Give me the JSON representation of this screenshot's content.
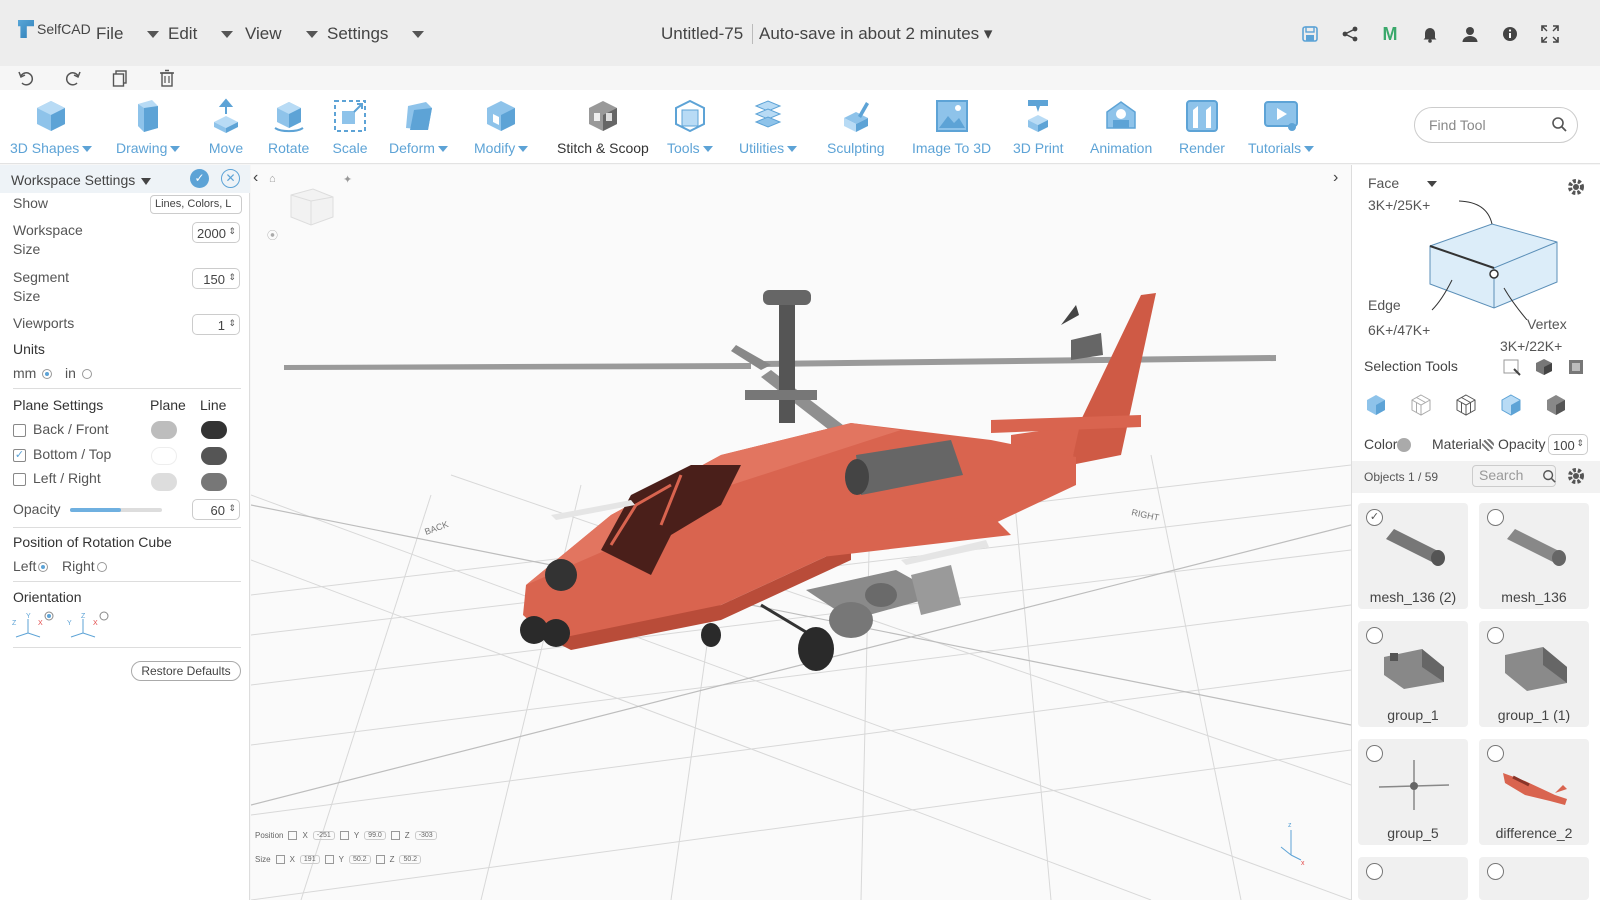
{
  "app": {
    "logo_text": "SelfCAD",
    "menus": [
      "File",
      "Edit",
      "View",
      "Settings"
    ],
    "doc_title": "Untitled-75",
    "autosave": "Auto-save in about 2 minutes ▾",
    "top_icons": [
      "save-icon",
      "share-icon",
      "m-logo-icon",
      "bell-icon",
      "user-icon",
      "info-icon",
      "fullscreen-icon"
    ],
    "secondary_icons": [
      "undo-icon",
      "redo-icon",
      "copy-icon",
      "trash-icon"
    ]
  },
  "toolbar": {
    "tools": [
      {
        "label": "3D Shapes",
        "dropdown": true
      },
      {
        "label": "Drawing",
        "dropdown": true
      },
      {
        "label": "Move",
        "dropdown": false
      },
      {
        "label": "Rotate",
        "dropdown": false
      },
      {
        "label": "Scale",
        "dropdown": false
      },
      {
        "label": "Deform",
        "dropdown": true
      },
      {
        "label": "Modify",
        "dropdown": true
      },
      {
        "label": "Stitch & Scoop",
        "dropdown": false
      },
      {
        "label": "Tools",
        "dropdown": true
      },
      {
        "label": "Utilities",
        "dropdown": true
      },
      {
        "label": "Sculpting",
        "dropdown": false
      },
      {
        "label": "Image To 3D",
        "dropdown": false
      },
      {
        "label": "3D Print",
        "dropdown": false
      },
      {
        "label": "Animation",
        "dropdown": false
      },
      {
        "label": "Render",
        "dropdown": false
      },
      {
        "label": "Tutorials",
        "dropdown": true
      }
    ],
    "find_placeholder": "Find Tool"
  },
  "workspace": {
    "title": "Workspace Settings",
    "show_label": "Show",
    "show_value": "Lines, Colors, L",
    "workspace_size_label_1": "Workspace",
    "workspace_size_label_2": "Size",
    "workspace_size": "2000",
    "segment_size_label_1": "Segment",
    "segment_size_label_2": "Size",
    "segment_size": "150",
    "viewports_label": "Viewports",
    "viewports": "1",
    "units_label": "Units",
    "unit_mm": "mm",
    "unit_in": "in",
    "plane_settings_label": "Plane Settings",
    "plane_col": "Plane",
    "line_col": "Line",
    "planes": [
      {
        "label": "Back / Front",
        "checked": false,
        "plane_color": "#bdbdbd",
        "line_color": "#333333"
      },
      {
        "label": "Bottom / Top",
        "checked": true,
        "plane_color": "#ffffff",
        "line_color": "#555555"
      },
      {
        "label": "Left / Right",
        "checked": false,
        "plane_color": "#dddddd",
        "line_color": "#777777"
      }
    ],
    "opacity_label": "Opacity",
    "opacity": "60",
    "opacity_level": 0.55,
    "rotation_cube_label": "Position of Rotation Cube",
    "rc_left": "Left",
    "rc_right": "Right",
    "orientation_label": "Orientation",
    "restore_label": "Restore Defaults"
  },
  "viewport": {
    "back_label": "BACK",
    "right_label": "RIGHT",
    "coords": {
      "position_label": "Position",
      "size_label": "Size",
      "x": "X",
      "y": "Y",
      "z": "Z",
      "pos_x": "-251",
      "pos_y": "99.0",
      "pos_z": "-303",
      "size_x": "191",
      "size_y": "50.2",
      "size_z": "50.2"
    }
  },
  "selection": {
    "mode": "Face",
    "face_count": "3K+/25K+",
    "edge_label": "Edge",
    "edge_count": "6K+/47K+",
    "vertex_label": "Vertex",
    "vertex_count": "3K+/22K+",
    "tools_label": "Selection Tools",
    "color_label": "Color",
    "material_label": "Material",
    "opacity_label": "Opacity",
    "opacity": "100",
    "objects_label": "Objects 1 / 59",
    "search_placeholder": "Search"
  },
  "objects": [
    {
      "name": "mesh_136 (2)",
      "selected": true,
      "kind": "tube"
    },
    {
      "name": "mesh_136",
      "selected": false,
      "kind": "tube"
    },
    {
      "name": "group_1",
      "selected": false,
      "kind": "pod"
    },
    {
      "name": "group_1 (1)",
      "selected": false,
      "kind": "pod"
    },
    {
      "name": "group_5",
      "selected": false,
      "kind": "rotor"
    },
    {
      "name": "difference_2",
      "selected": false,
      "kind": "heli"
    }
  ],
  "colors": {
    "accent": "#5da3d6",
    "helicopter_body": "#d9644f"
  }
}
